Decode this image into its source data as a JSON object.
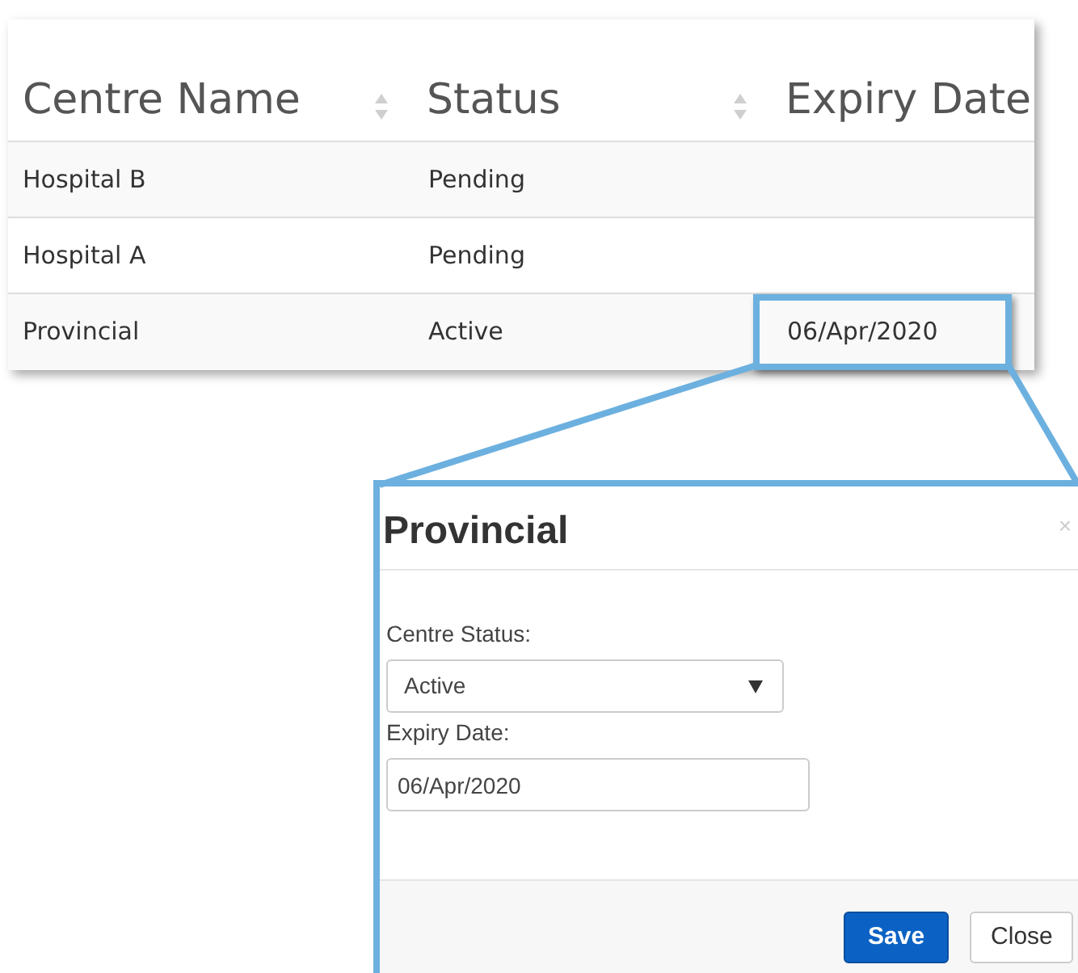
{
  "table": {
    "columns": [
      {
        "label": "Centre Name",
        "sortable": true
      },
      {
        "label": "Status",
        "sortable": true
      },
      {
        "label": "Expiry Date",
        "sortable": false
      }
    ],
    "rows": [
      {
        "name": "Hospital B",
        "status": "Pending",
        "callout": false
      },
      {
        "name": "Hospital A",
        "status": "Pending",
        "callout": false
      },
      {
        "name": "Provincial",
        "status": "Active",
        "expiry": "06/Apr/2020",
        "callout": true
      }
    ]
  },
  "modal": {
    "title": "Provincial",
    "close_glyph": "×",
    "fields": [
      {
        "kind": "select",
        "label": "Centre Status:",
        "value": "Active"
      },
      {
        "kind": "text",
        "label": "Expiry Date:",
        "value": "06/Apr/2020"
      }
    ],
    "buttons": [
      {
        "label": "Save",
        "primary": true
      },
      {
        "label": "Close",
        "primary": false
      }
    ]
  }
}
